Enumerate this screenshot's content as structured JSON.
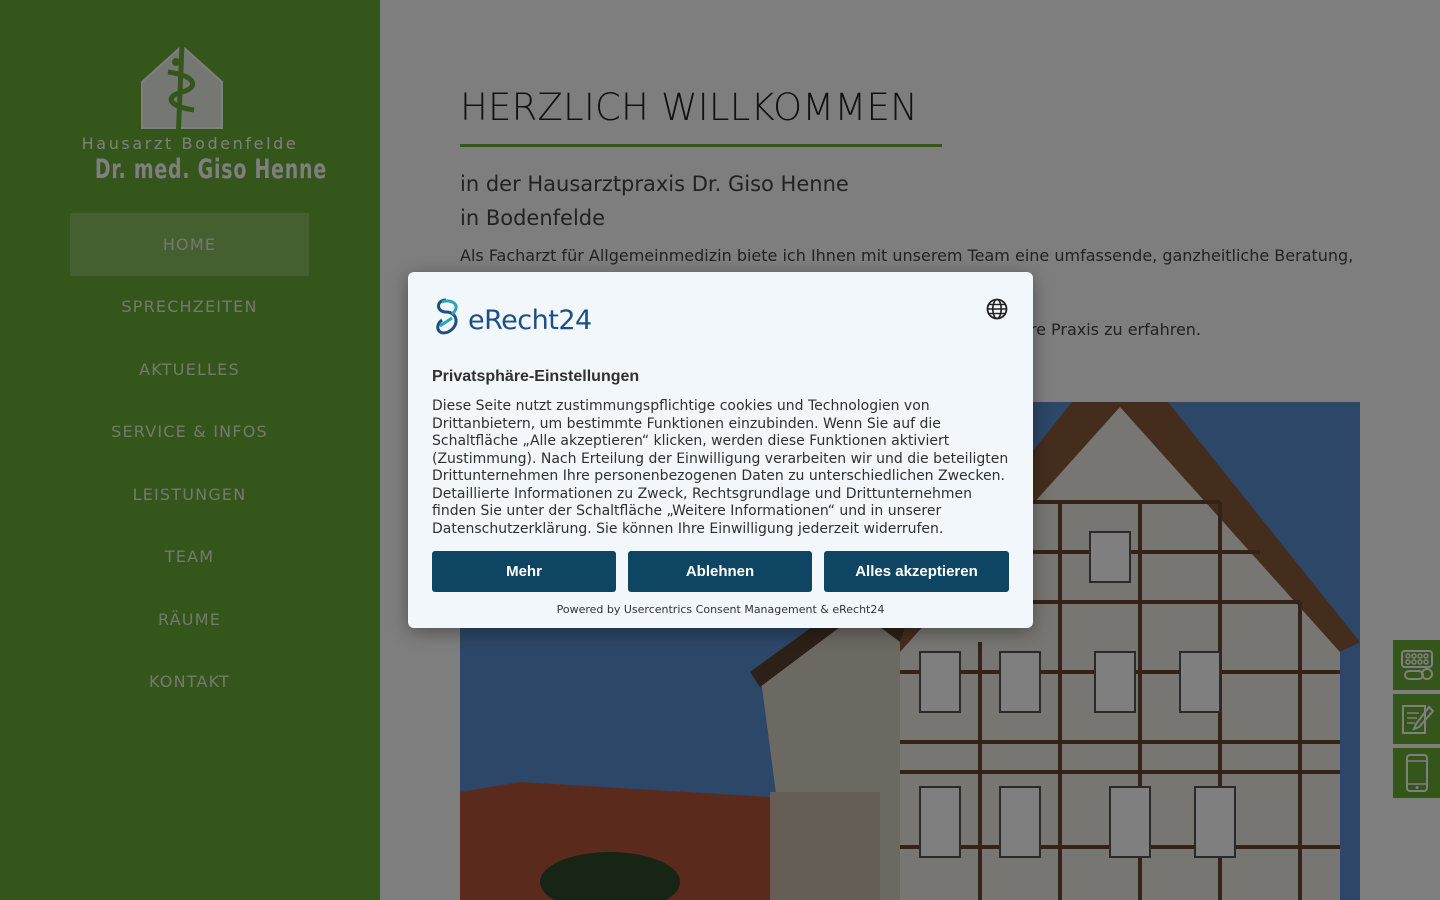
{
  "logo": {
    "line1": "Hausarzt Bodenfelde",
    "line2": "Dr. med. Giso Henne"
  },
  "nav": {
    "items": [
      {
        "label": "HOME"
      },
      {
        "label": "SPRECHZEITEN"
      },
      {
        "label": "AKTUELLES"
      },
      {
        "label": "SERVICE & INFOS"
      },
      {
        "label": "LEISTUNGEN"
      },
      {
        "label": "TEAM"
      },
      {
        "label": "RÄUME"
      },
      {
        "label": "KONTAKT"
      }
    ],
    "active": "HOME"
  },
  "main": {
    "heading": "HERZLICH WILLKOMMEN",
    "subheading_line1": "in der Hausarztpraxis Dr. Giso Henne",
    "subheading_line2": "in Bodenfelde",
    "paragraph1": "Als Facharzt für Allgemeinmedizin biete ich Ihnen mit unserem Team eine umfassende, ganzheitliche Beratung,",
    "paragraph2_visible": "ere Praxis zu erfahren."
  },
  "side_tabs": [
    {
      "icon": "pills-icon"
    },
    {
      "icon": "prescription-edit-icon"
    },
    {
      "icon": "smartphone-icon"
    }
  ],
  "consent": {
    "brand": "eRecht24",
    "title": "Privatsphäre-Einstellungen",
    "body": "Diese Seite nutzt zustimmungspflichtige cookies und Technologien von Drittanbietern, um bestimmte Funktionen einzubinden. Wenn Sie auf die Schaltfläche „Alle akzeptieren“ klicken, werden diese Funktionen aktiviert (Zustimmung). Nach Erteilung der Einwilligung verarbeiten wir und die beteiligten Drittunternehmen Ihre personenbezogenen Daten zu unterschiedlichen Zwecken. Detaillierte Informationen zu Zweck, Rechtsgrundlage und Drittunternehmen finden Sie unter der Schaltfläche „Weitere Informationen“ und in unserer Datenschutzerklärung. Sie können Ihre Einwilligung jederzeit widerrufen.",
    "buttons": {
      "more": "Mehr",
      "decline": "Ablehnen",
      "accept_all": "Alles akzeptieren"
    },
    "powered_by": "Powered by Usercentrics Consent Management & eRecht24"
  },
  "colors": {
    "sidebar_green": "#6aac36",
    "active_nav": "#8bbe62",
    "button_navy": "#0d4563",
    "dialog_bg": "#f2f7fc"
  }
}
